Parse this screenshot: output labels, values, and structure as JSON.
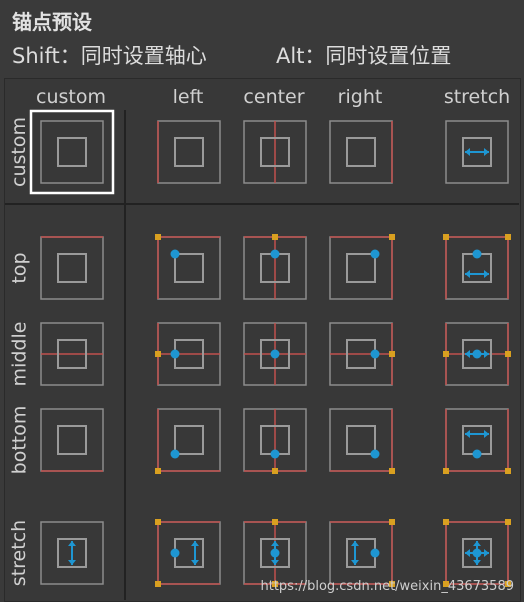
{
  "header": {
    "title": "锚点预设",
    "shift_hint": "Shift：同时设置轴心",
    "alt_hint": "Alt：同时设置位置"
  },
  "columns": [
    {
      "key": "custom",
      "label": "custom"
    },
    {
      "key": "left",
      "label": "left"
    },
    {
      "key": "center",
      "label": "center"
    },
    {
      "key": "right",
      "label": "right"
    },
    {
      "key": "stretch",
      "label": "stretch"
    }
  ],
  "rows": [
    {
      "key": "custom",
      "label": "custom"
    },
    {
      "key": "top",
      "label": "top"
    },
    {
      "key": "middle",
      "label": "middle"
    },
    {
      "key": "bottom",
      "label": "bottom"
    },
    {
      "key": "stretch",
      "label": "stretch"
    }
  ],
  "selected_preset": "custom-custom",
  "colors": {
    "background": "#3a3a3a",
    "outline": "#8c8c8c",
    "anchor_line": "#c0504d",
    "anchor_corner": "#d9a020",
    "pivot": "#1e96d2",
    "selection": "#ffffff"
  },
  "watermark": "https://blog.csdn.net/weixin_43673589"
}
